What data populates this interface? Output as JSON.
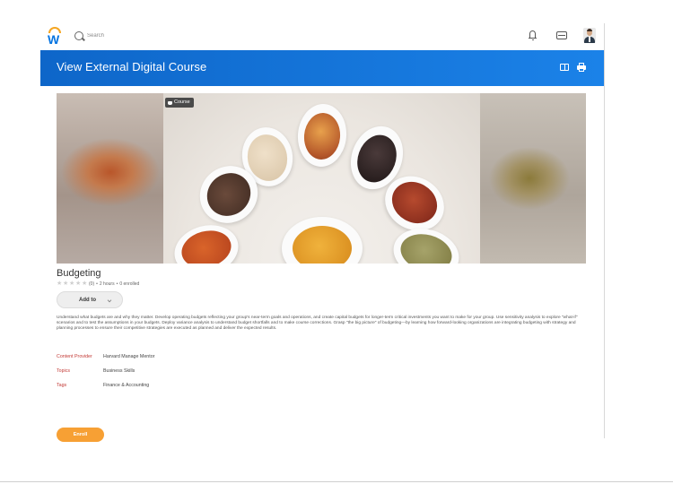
{
  "nav": {
    "search_placeholder": "Search"
  },
  "header": {
    "title": "View External Digital Course"
  },
  "hero": {
    "badge": "Course"
  },
  "course": {
    "title": "Budgeting",
    "rating_count": "(0)",
    "duration": "2 hours",
    "enrolled": "0 enrolled",
    "add_label": "Add to",
    "description": "Understand what budgets are and why they matter. Develop operating budgets reflecting your group's near-term goals and operations, and create capital budgets for longer-term critical investments you want to make for your group. Use sensitivity analysis to explore \"what-if\" scenarios and to test the assumptions in your budgets. Deploy variance analysis to understand budget shortfalls and to make course corrections. Grasp \"the big picture\" of budgeting—by learning how forward-looking organizations are integrating budgeting with strategy and planning processes to ensure their competitive strategies are executed as planned and deliver the expected results.",
    "fields": [
      {
        "label": "Content Provider",
        "value": "Harvard Manage Mentor"
      },
      {
        "label": "Topics",
        "value": "Business Skills"
      },
      {
        "label": "Tags",
        "value": "Finance & Accounting"
      }
    ],
    "enroll_label": "Enroll"
  },
  "colors": {
    "header_blue": "#1b82e8",
    "field_label_red": "#c33a36",
    "enroll_orange": "#f7a034"
  }
}
